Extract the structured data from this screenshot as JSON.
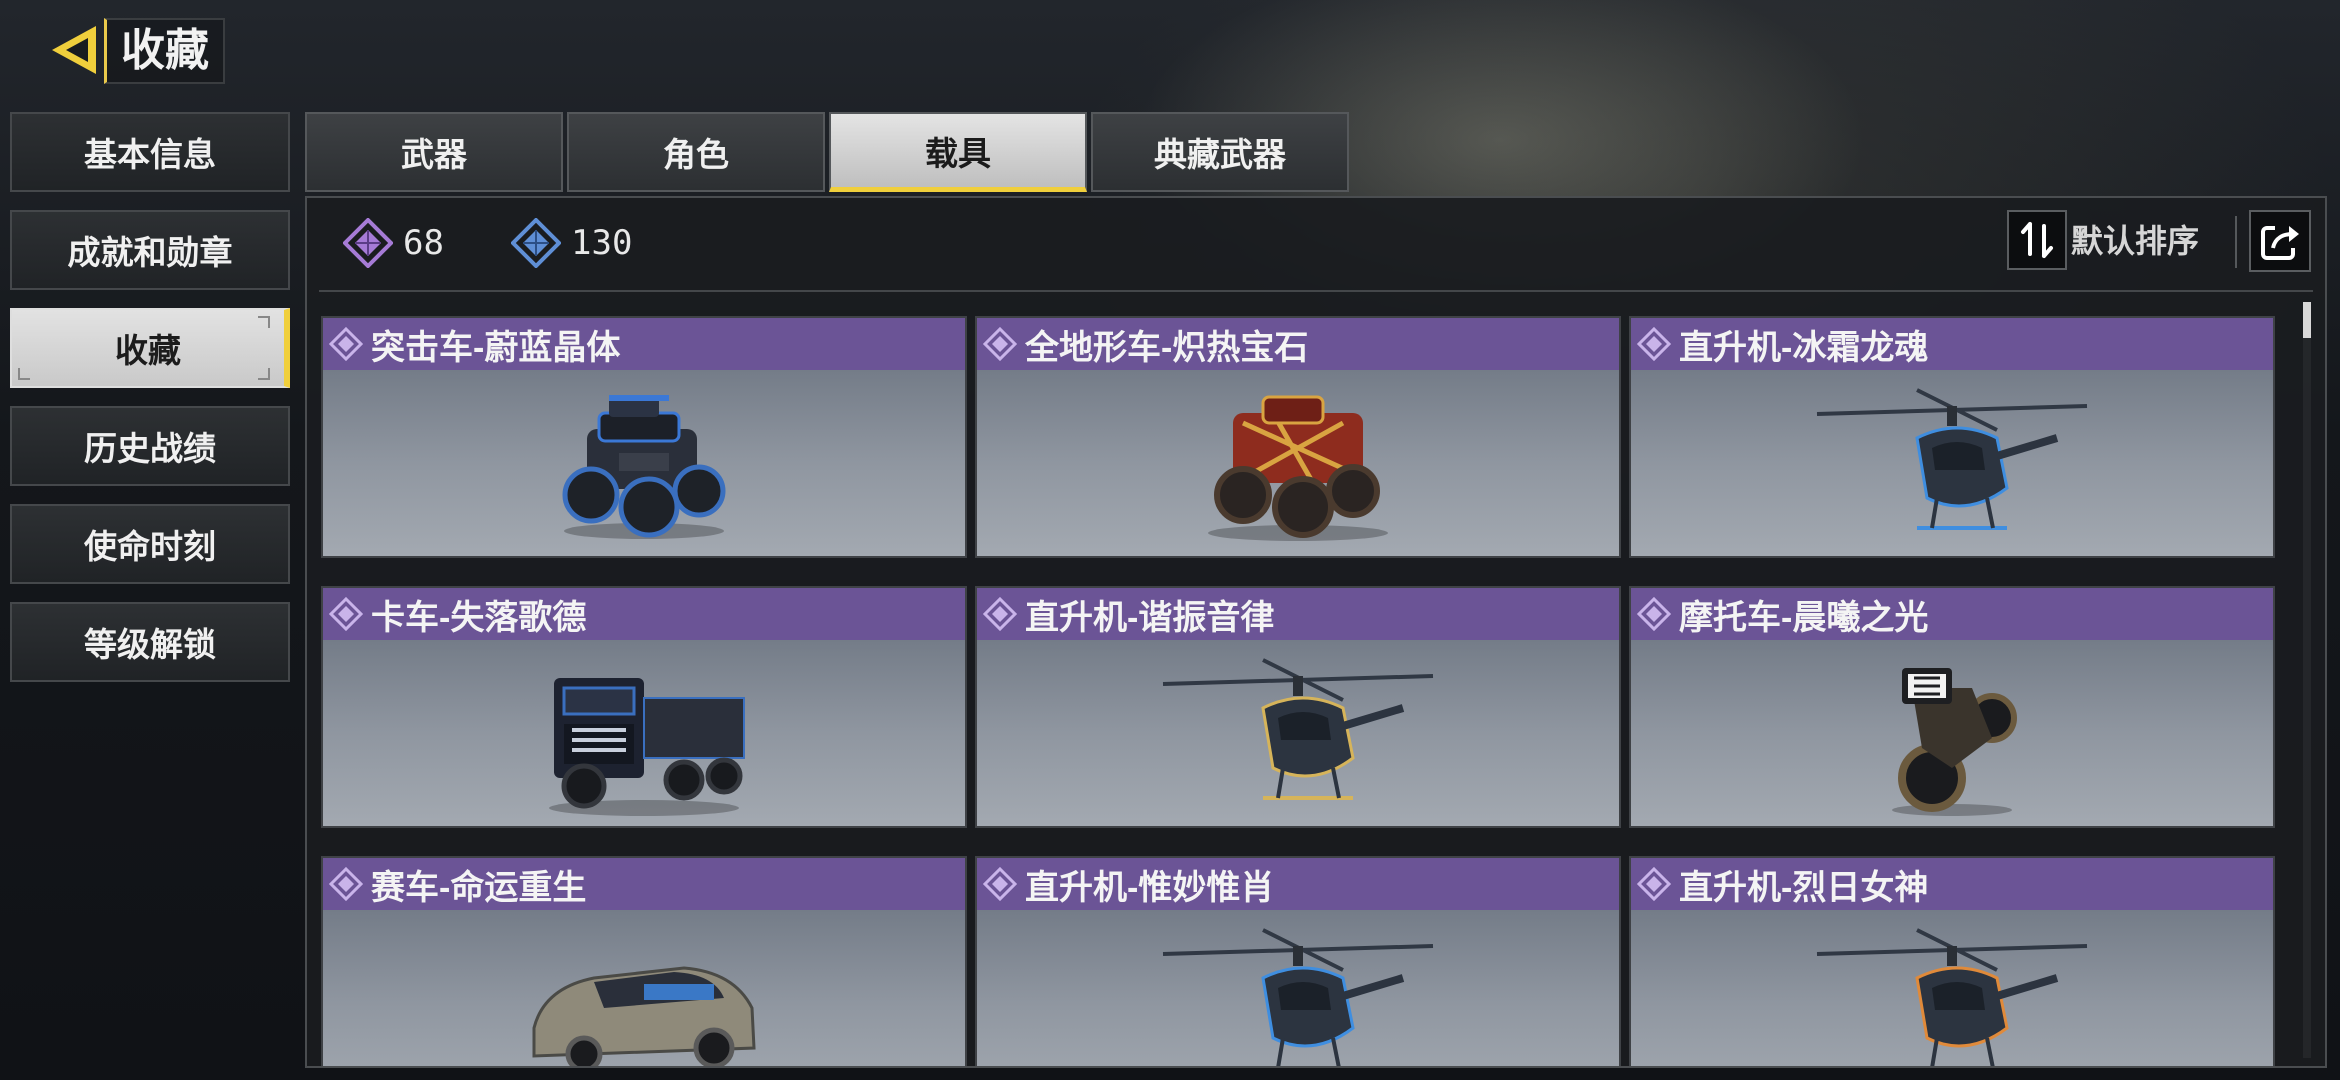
{
  "header": {
    "title": "收藏"
  },
  "sidebar": {
    "items": [
      {
        "label": "基本信息"
      },
      {
        "label": "成就和勋章"
      },
      {
        "label": "收藏"
      },
      {
        "label": "历史战绩"
      },
      {
        "label": "使命时刻"
      },
      {
        "label": "等级解锁"
      }
    ],
    "active_index": 2
  },
  "tabs": [
    {
      "label": "武器"
    },
    {
      "label": "角色"
    },
    {
      "label": "载具"
    },
    {
      "label": "典藏武器"
    }
  ],
  "active_tab": 2,
  "currency": {
    "purple": "68",
    "blue": "130",
    "purple_color": "#a67bd6",
    "blue_color": "#5f8fd6"
  },
  "sort": {
    "label": "默认排序",
    "icon": "sort-icon"
  },
  "share": {
    "icon": "share-icon"
  },
  "cards": [
    {
      "name": "突击车-蔚蓝晶体",
      "kind": "buggy"
    },
    {
      "name": "全地形车-炽热宝石",
      "kind": "atv"
    },
    {
      "name": "直升机-冰霜龙魂",
      "kind": "helicopter"
    },
    {
      "name": "卡车-失落歌德",
      "kind": "truck"
    },
    {
      "name": "直升机-谐振音律",
      "kind": "helicopter"
    },
    {
      "name": "摩托车-晨曦之光",
      "kind": "motorcycle"
    },
    {
      "name": "赛车-命运重生",
      "kind": "racecar"
    },
    {
      "name": "直升机-惟妙惟肖",
      "kind": "helicopter"
    },
    {
      "name": "直升机-烈日女神",
      "kind": "helicopter"
    }
  ],
  "colors": {
    "accent": "#f0cf3c",
    "card_header": "#6b5496"
  }
}
